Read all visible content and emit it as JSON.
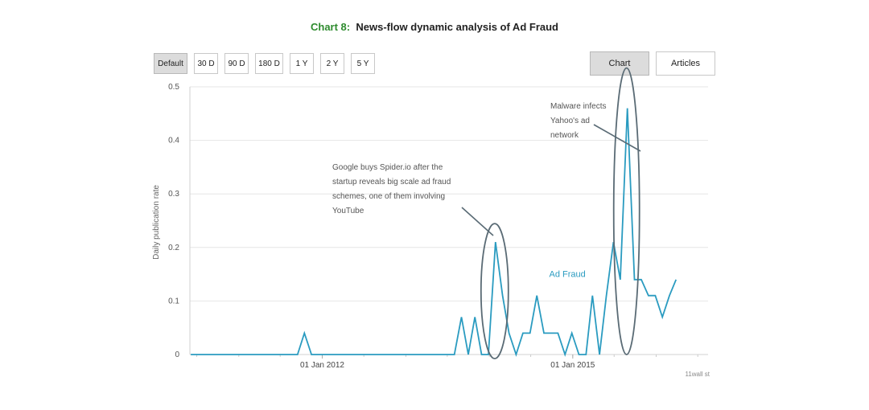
{
  "title": {
    "number": "Chart 8:",
    "text": "News-flow dynamic analysis of Ad Fraud"
  },
  "range_buttons": [
    "Default",
    "30 D",
    "90 D",
    "180 D",
    "1 Y",
    "2 Y",
    "5 Y"
  ],
  "view_tabs": [
    "Chart",
    "Articles"
  ],
  "source_label": "11wall st",
  "colors": {
    "series": "#2a9bc0",
    "title_number": "#2e8b2e",
    "annotation": "#5a6b75",
    "grid": "#e6e6e6"
  },
  "chart_data": {
    "type": "line",
    "ylabel": "Daily publication rate",
    "ylim": [
      0,
      0.5
    ],
    "yticks": [
      0,
      0.1,
      0.2,
      0.3,
      0.4,
      0.5
    ],
    "ytick_labels": [
      "0",
      "0.1",
      "0.2",
      "0.3",
      "0.4",
      "0.5"
    ],
    "xlim": [
      "2010-06-01",
      "2016-08-15"
    ],
    "xticks": [
      {
        "date": "2012-01-01",
        "label": "01 Jan 2012"
      },
      {
        "date": "2015-01-01",
        "label": "01 Jan 2015"
      }
    ],
    "grid": true,
    "series": [
      {
        "name": "Ad Fraud",
        "points": [
          [
            "2010-06-05",
            0
          ],
          [
            "2011-09-15",
            0
          ],
          [
            "2011-10-15",
            0.04
          ],
          [
            "2011-11-15",
            0
          ],
          [
            "2013-08-01",
            0
          ],
          [
            "2013-09-01",
            0.07
          ],
          [
            "2013-10-01",
            0
          ],
          [
            "2013-10-30",
            0.07
          ],
          [
            "2013-11-28",
            0
          ],
          [
            "2013-12-28",
            0
          ],
          [
            "2014-01-28",
            0.21
          ],
          [
            "2014-02-28",
            0.11
          ],
          [
            "2014-03-28",
            0.04
          ],
          [
            "2014-04-28",
            0
          ],
          [
            "2014-05-28",
            0.04
          ],
          [
            "2014-06-28",
            0.04
          ],
          [
            "2014-07-28",
            0.11
          ],
          [
            "2014-08-28",
            0.04
          ],
          [
            "2014-09-28",
            0.04
          ],
          [
            "2014-10-28",
            0.04
          ],
          [
            "2014-11-28",
            0
          ],
          [
            "2014-12-28",
            0.04
          ],
          [
            "2015-01-28",
            0
          ],
          [
            "2015-02-28",
            0
          ],
          [
            "2015-03-28",
            0.11
          ],
          [
            "2015-04-28",
            0
          ],
          [
            "2015-05-28",
            0.11
          ],
          [
            "2015-06-28",
            0.21
          ],
          [
            "2015-07-28",
            0.14
          ],
          [
            "2015-08-28",
            0.46
          ],
          [
            "2015-09-28",
            0.14
          ],
          [
            "2015-10-28",
            0.14
          ],
          [
            "2015-11-28",
            0.11
          ],
          [
            "2015-12-28",
            0.11
          ],
          [
            "2016-01-28",
            0.07
          ],
          [
            "2016-02-28",
            0.11
          ],
          [
            "2016-03-28",
            0.14
          ]
        ]
      }
    ],
    "annotations": [
      {
        "lines": [
          "Google buys Spider.io after the",
          "startup reveals big scale ad fraud",
          "schemes, one of them involving",
          "YouTube"
        ],
        "date": "2014-01-28",
        "value": 0.21
      },
      {
        "lines": [
          "Malware infects",
          "Yahoo's ad",
          "network"
        ],
        "date": "2015-08-28",
        "value": 0.46
      }
    ]
  }
}
